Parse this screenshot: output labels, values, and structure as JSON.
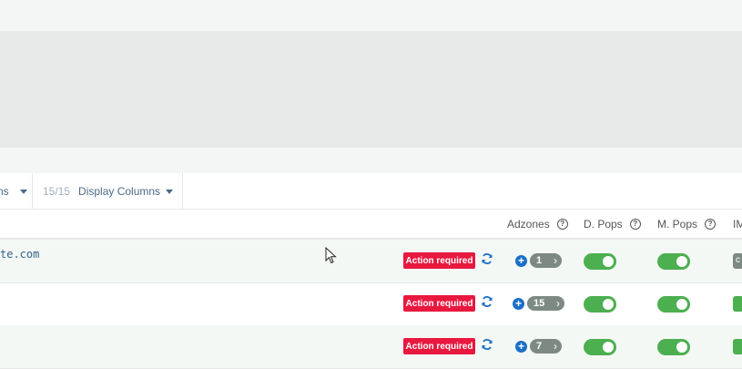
{
  "toolbar": {
    "left_partial_label": "ns",
    "columns_count": "15/15",
    "columns_label": "Display Columns"
  },
  "headers": {
    "adzones": "Adzones",
    "dpops": "D. Pops",
    "mpops": "M. Pops",
    "im_partial": "IM"
  },
  "rows": [
    {
      "site": "te.com",
      "status_badge": "Action required",
      "adzones_count": "1",
      "dpops_on": true,
      "mpops_on": true
    },
    {
      "site": "",
      "status_badge": "Action required",
      "adzones_count": "15",
      "dpops_on": true,
      "mpops_on": true
    },
    {
      "site": "",
      "status_badge": "Action required",
      "adzones_count": "7",
      "dpops_on": true,
      "mpops_on": true
    }
  ],
  "colors": {
    "badge_red": "#e8183f",
    "toggle_green": "#4caf50",
    "pill_grey": "#7d8a84",
    "plus_blue": "#1b6fc8",
    "link_blue": "#4a6b8a"
  },
  "icons": {
    "refresh": "refresh-icon",
    "add": "plus-circle-icon",
    "help": "question-circle-icon",
    "chevron": "chevron-right-icon",
    "caret": "caret-down-icon"
  }
}
